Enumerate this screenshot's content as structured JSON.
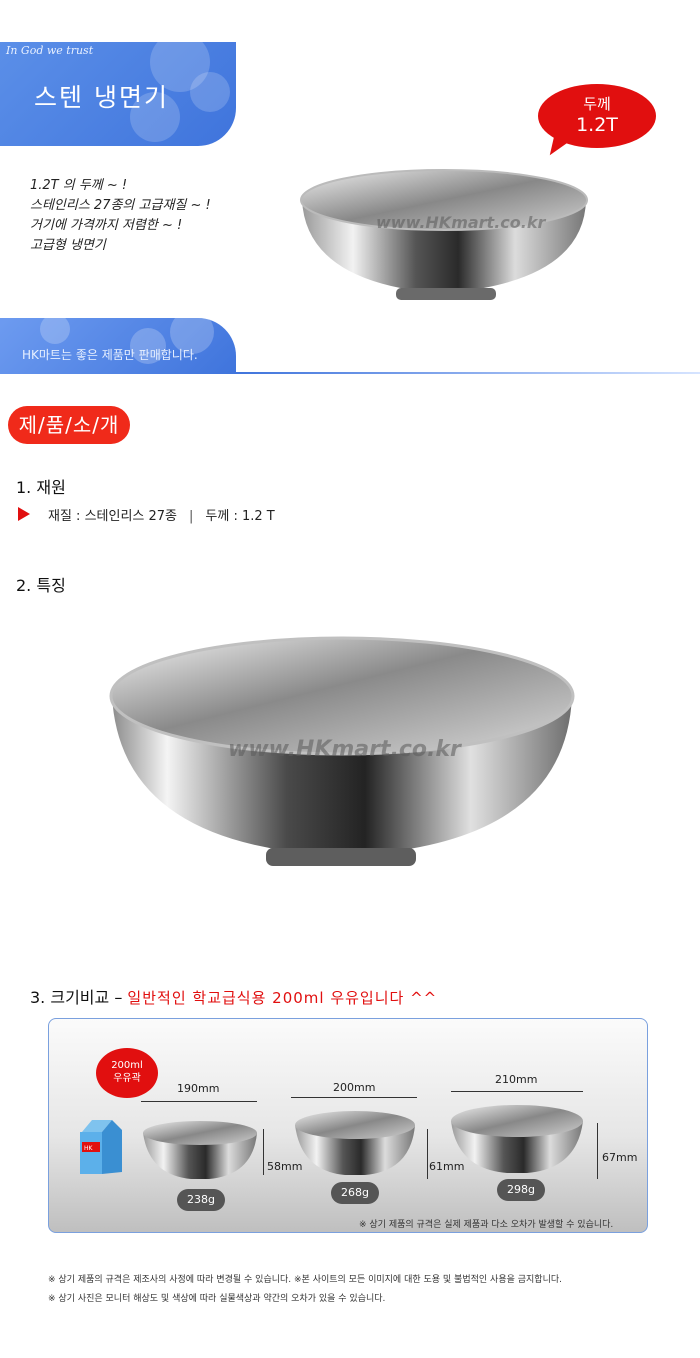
{
  "header": {
    "tagline": "In God we trust",
    "title": "스텐 냉면기",
    "callout": {
      "line1": "두께",
      "line2": "1.2T"
    },
    "intro_lines": [
      "1.2T 의 두께 ~ !",
      "스테인리스 27종의 고급재질 ~ !",
      "거기에 가격까지 저렴한 ~ !",
      "고급형 냉면기"
    ],
    "store_slogan": "HK마트는 좋은 제품만 판매합니다."
  },
  "watermark": "www.HKmart.co.kr",
  "product_intro": {
    "heading": "제/품/소/개",
    "spec_title": "1. 재원",
    "spec_material": "재질 : 스테인리스 27종",
    "spec_separator": "|",
    "spec_thickness": "두께 : 1.2 T",
    "feature_title": "2. 특징",
    "compare_title": "3. 크기비교 –",
    "compare_highlight": "일반적인 학교급식용 200ml 우유입니다 ^^"
  },
  "comparison": {
    "milk_label_line1": "200ml",
    "milk_label_line2": "우유곽",
    "carton_text": "HK",
    "bowls": [
      {
        "width": "190mm",
        "height": "58mm",
        "weight": "238g"
      },
      {
        "width": "200mm",
        "height": "61mm",
        "weight": "268g"
      },
      {
        "width": "210mm",
        "height": "67mm",
        "weight": "298g"
      }
    ],
    "note": "※ 상기 제품의 규격은 실제 제품과 다소 오차가 발생할 수 있습니다."
  },
  "footer": {
    "line1": "※ 상기 제품의 규격은 제조사의 사정에 따라 변경될 수 있습니다.   ※본 사이트의 모든 이미지에 대한 도용 및 불법적인 사용을 금지합니다.",
    "line2": "※ 상기 사진은 모니터 해상도 및 색상에 따라 실물색상과 약간의 오차가 있을 수 있습니다."
  },
  "colors": {
    "accent_red": "#e10f0f",
    "banner_blue": "#3f74dc"
  }
}
